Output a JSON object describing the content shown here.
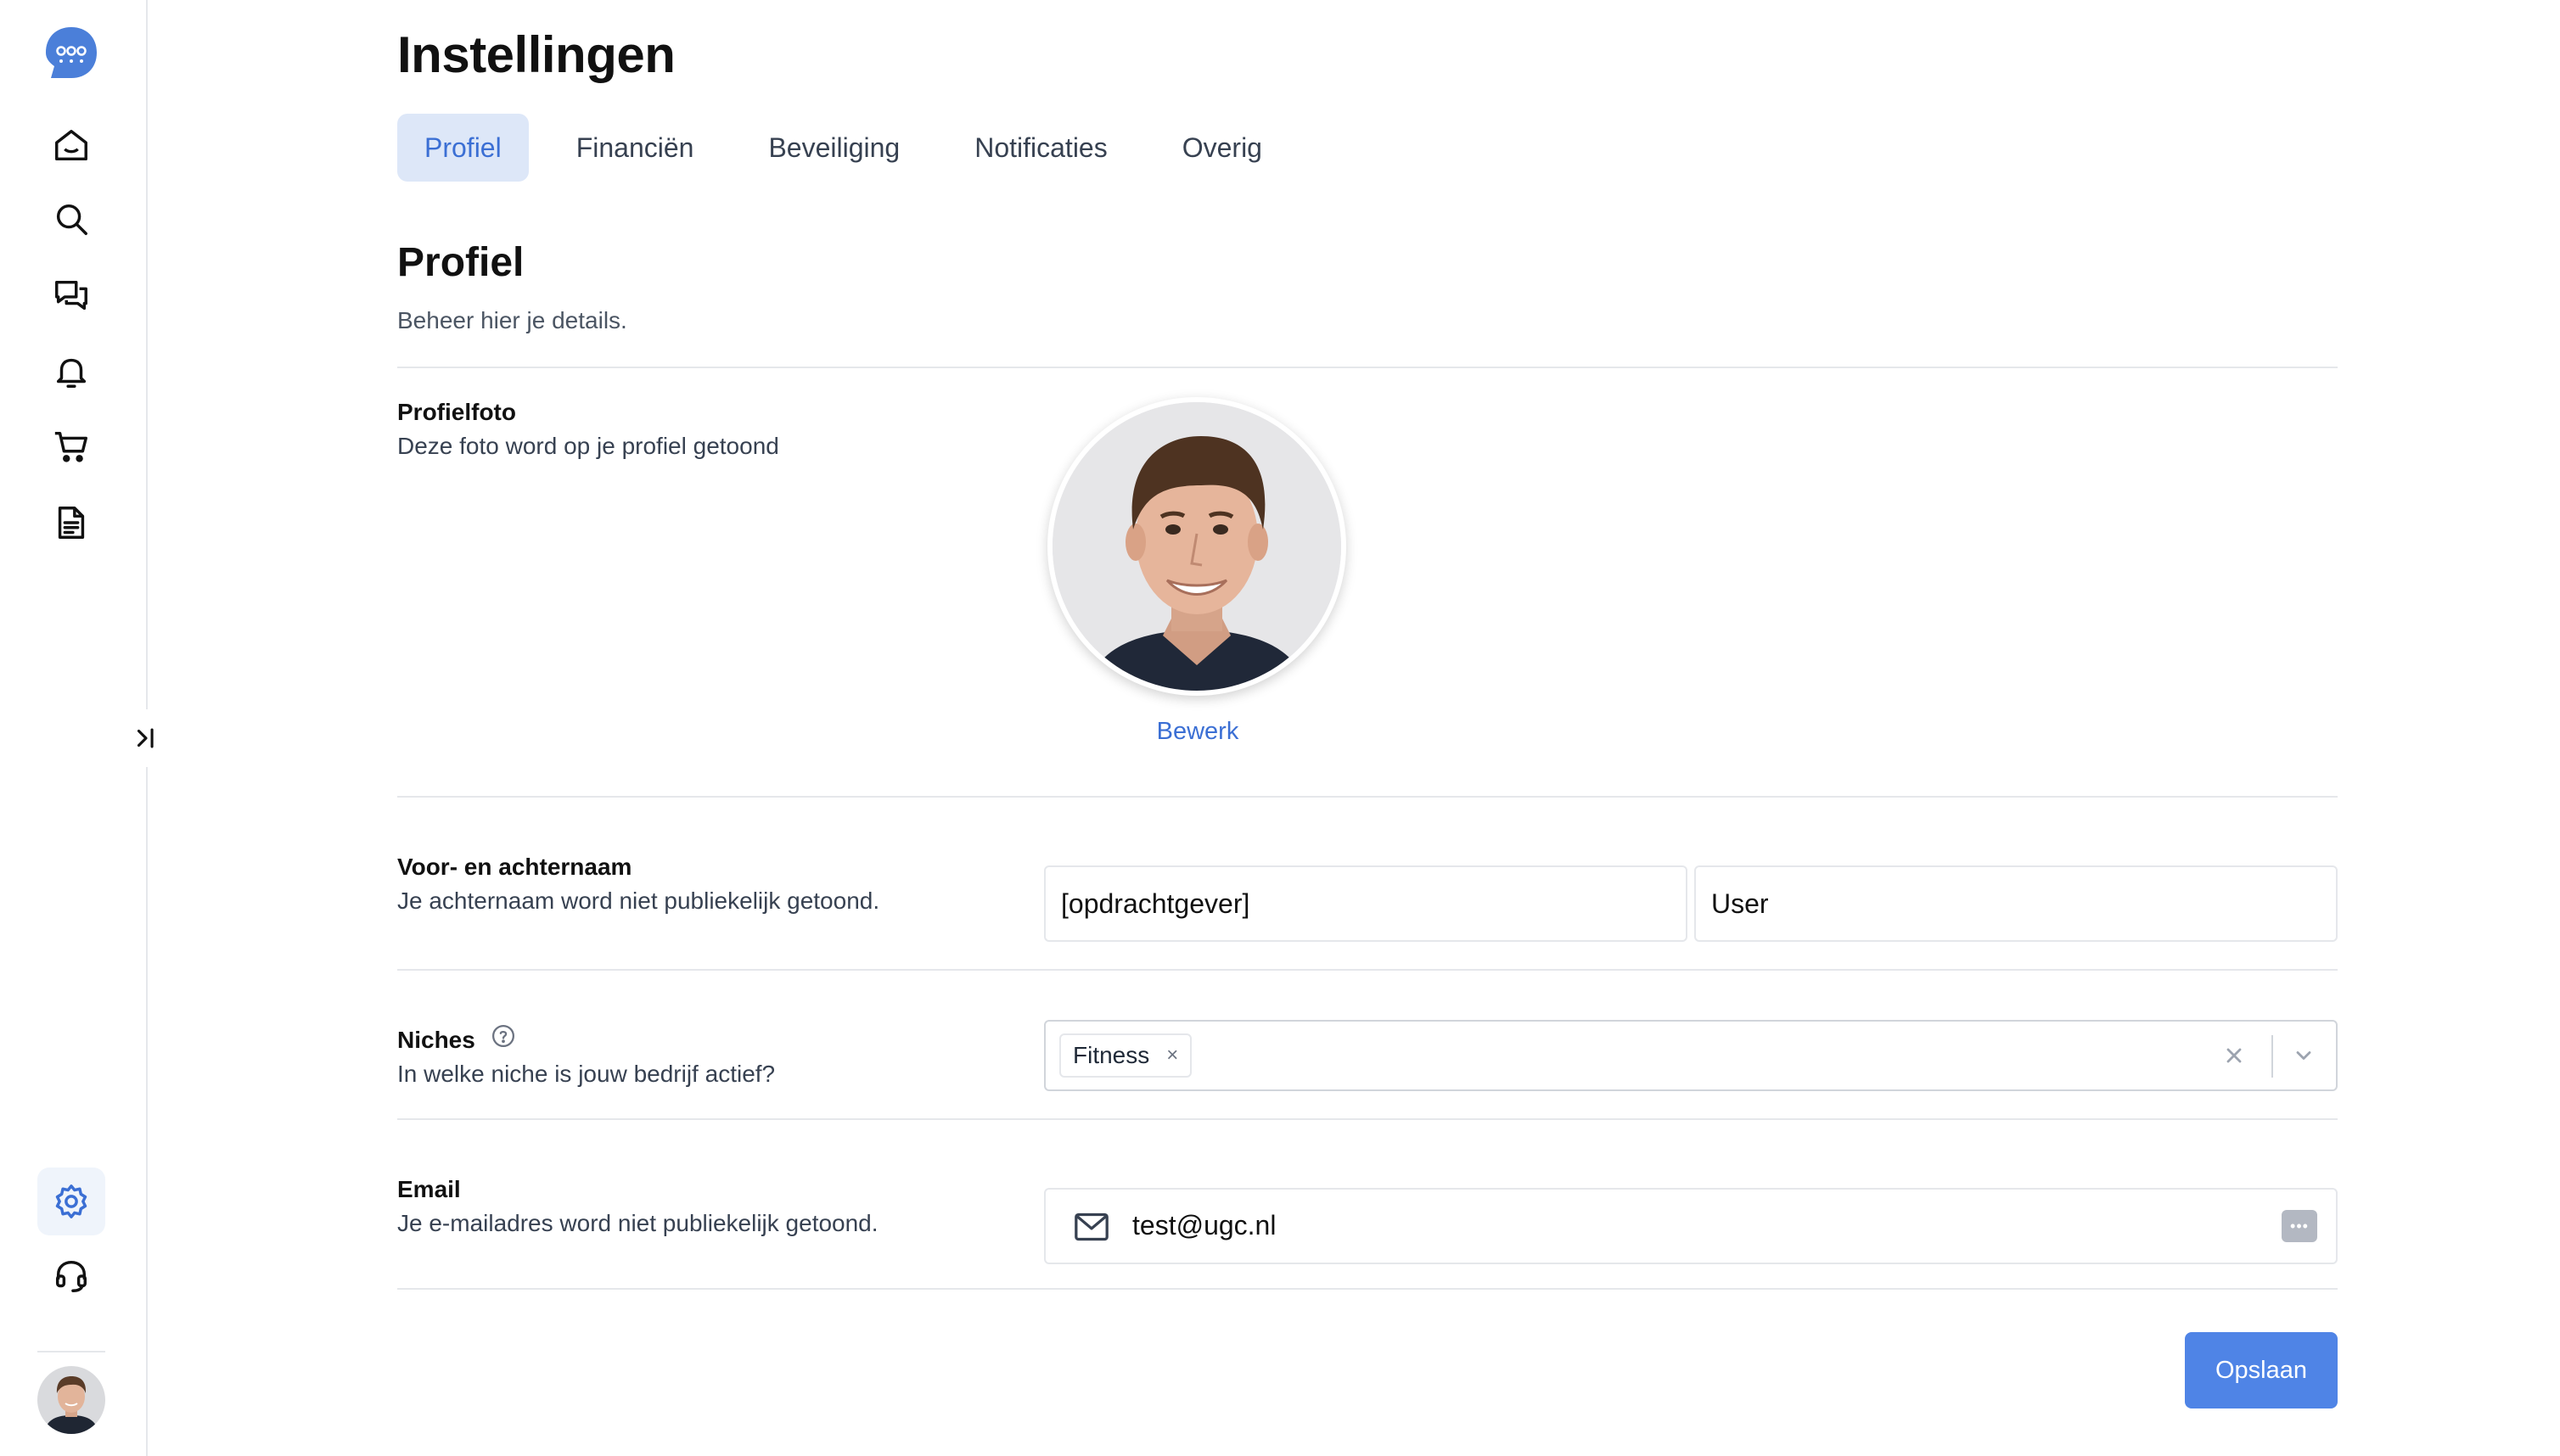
{
  "page": {
    "title": "Instellingen"
  },
  "tabs": [
    {
      "label": "Profiel",
      "active": true
    },
    {
      "label": "Financiën",
      "active": false
    },
    {
      "label": "Beveiliging",
      "active": false
    },
    {
      "label": "Notificaties",
      "active": false
    },
    {
      "label": "Overig",
      "active": false
    }
  ],
  "sidebar": {
    "logo": "logo-icon",
    "items": [
      {
        "icon": "home-icon"
      },
      {
        "icon": "search-icon"
      },
      {
        "icon": "chat-icon"
      },
      {
        "icon": "bell-icon"
      },
      {
        "icon": "cart-icon"
      },
      {
        "icon": "document-icon"
      }
    ],
    "bottom_items": [
      {
        "icon": "gear-icon",
        "active": true
      },
      {
        "icon": "headset-icon"
      }
    ],
    "collapse_icon": "expand-sidebar-icon",
    "accent_color": "#3b6fd4"
  },
  "section": {
    "title": "Profiel",
    "subtitle": "Beheer hier je details."
  },
  "photo": {
    "label": "Profielfoto",
    "description": "Deze foto word op je profiel getoond",
    "edit_label": "Bewerk"
  },
  "name": {
    "label": "Voor- en achternaam",
    "description": "Je achternaam word niet publiekelijk getoond.",
    "first_name": "[opdrachtgever]",
    "last_name": "User"
  },
  "niches": {
    "label": "Niches",
    "description": "In welke niche is jouw bedrijf actief?",
    "selected": [
      "Fitness"
    ],
    "chip_remove": "×"
  },
  "email": {
    "label": "Email",
    "description": "Je e-mailadres word niet publiekelijk getoond.",
    "value": "test@ugc.nl"
  },
  "actions": {
    "save_label": "Opslaan",
    "save_color": "#4f84e6"
  }
}
